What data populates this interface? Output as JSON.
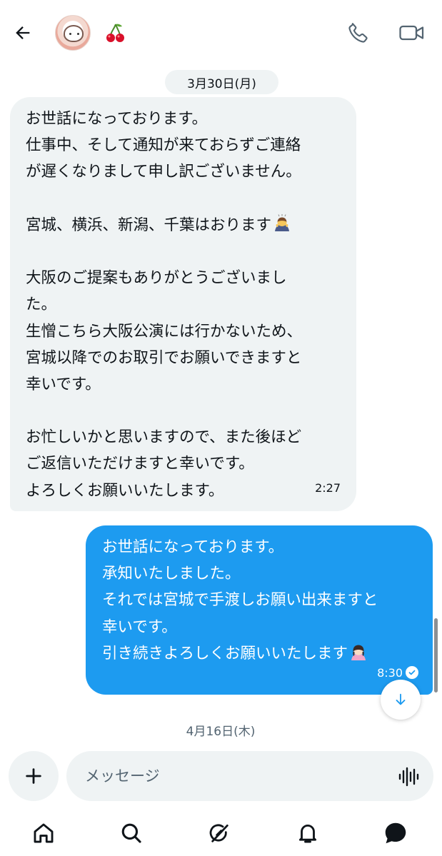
{
  "header": {
    "back_icon": "arrow-left-icon",
    "avatar_icon": "hamster-avatar",
    "display_name_emoji": "cherries-emoji",
    "call_icon": "phone-icon",
    "video_icon": "video-camera-icon"
  },
  "conversation": {
    "date_dividers": [
      "3月30日(月)",
      "4月16日(木)"
    ],
    "received_message": {
      "lines": [
        "お世話になっております。",
        "仕事中、そして通知が来ておらずご連絡",
        "が遅くなりまして申し訳ございません。",
        "",
        "宮城、横浜、新潟、千葉はおります",
        "",
        "大阪のご提案もありがとうございまし",
        "た。",
        "生憎こちら大阪公演には行かないため、",
        "宮城以降でのお取引でお願いできますと",
        "幸いです。",
        "",
        "お忙しいかと思いますので、また後ほど",
        "ご返信いただけますと幸いです。",
        "よろしくお願いいたします。"
      ],
      "emoji": "person-bowing-emoji",
      "time": "2:27"
    },
    "sent_message": {
      "lines": [
        "お世話になっております。",
        "承知いたしました。",
        "それでは宮城で手渡しお願い出来ますと",
        "幸いです。",
        "引き続きよろしくお願いいたします"
      ],
      "emoji": "woman-bowing-emoji",
      "time": "8:30",
      "status_icon": "read-check-icon"
    }
  },
  "composer": {
    "placeholder": "メッセージ",
    "add_icon": "plus-icon",
    "voice_icon": "voice-waveform-icon"
  },
  "bottom_nav": [
    "home-icon",
    "search-icon",
    "grok-icon",
    "notifications-icon",
    "messages-icon"
  ],
  "colors": {
    "accent": "#1d9bf0",
    "received_bubble": "#eff3f4",
    "text": "#0f1419",
    "muted": "#536471"
  }
}
